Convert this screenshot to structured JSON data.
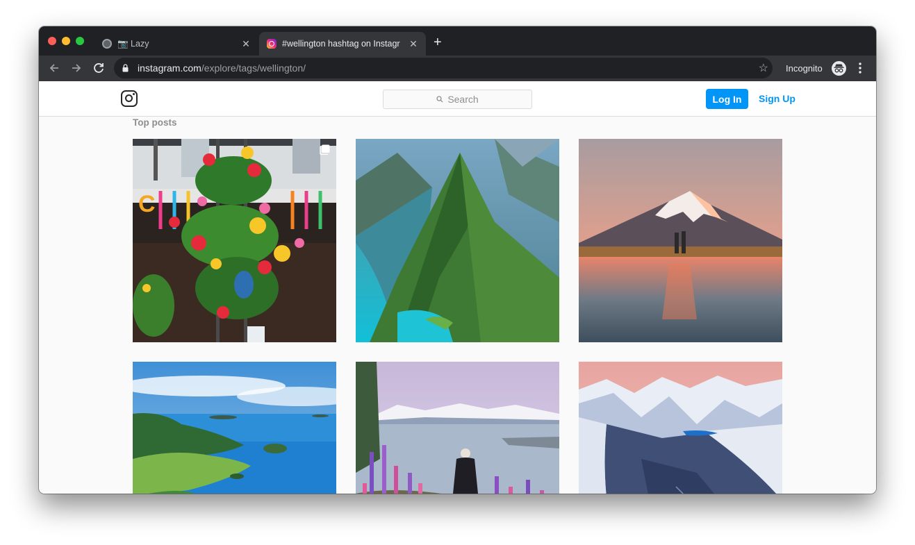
{
  "browser": {
    "tabs": [
      {
        "title": "📷 Lazy",
        "active": false,
        "favicon": "globe-icon"
      },
      {
        "title": "#wellington hashtag on Instagr",
        "active": true,
        "favicon": "instagram-icon"
      }
    ],
    "new_tab_glyph": "+",
    "close_glyph": "✕",
    "url_domain": "instagram.com",
    "url_path": "/explore/tags/wellington/",
    "incognito_label": "Incognito"
  },
  "instagram": {
    "search_placeholder": "Search",
    "login_label": "Log In",
    "signup_label": "Sign Up",
    "section_title": "Top posts",
    "accent_color": "#0095f6",
    "posts": [
      {
        "subject": "hanging flower baskets",
        "multiple": true
      },
      {
        "subject": "green mountain fjord",
        "multiple": false
      },
      {
        "subject": "snow-capped volcano at sunset",
        "multiple": false
      },
      {
        "subject": "coastal islands blue sea",
        "multiple": false
      },
      {
        "subject": "lake with lupins and mountains",
        "multiple": false
      },
      {
        "subject": "snowy mountain range",
        "multiple": false
      }
    ]
  }
}
